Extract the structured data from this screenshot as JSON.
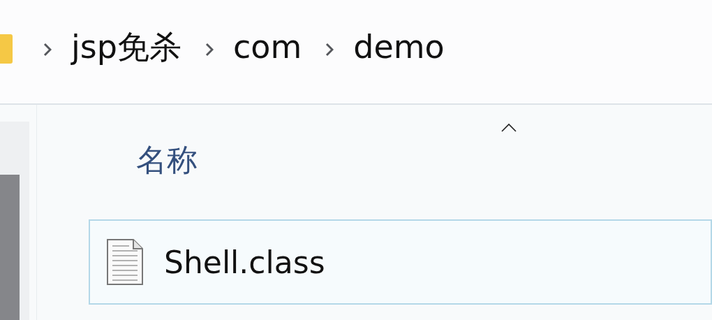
{
  "breadcrumb": [
    "jsp免杀",
    "com",
    "demo"
  ],
  "column_header": {
    "label": "名称",
    "sorted_ascending": true
  },
  "files": [
    {
      "name": "Shell.class",
      "selected": true
    }
  ]
}
